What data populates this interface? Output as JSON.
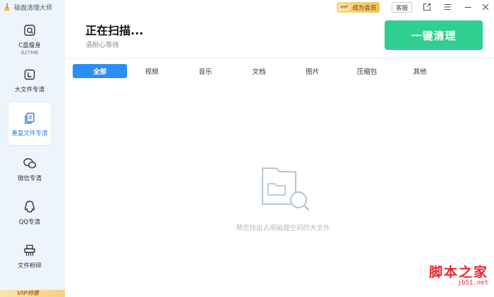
{
  "app": {
    "title": "磁盘清理大师"
  },
  "titlebar": {
    "vip_badge": "VIP",
    "vip_label": "成为会员",
    "service_label": "客服",
    "icons": [
      "share-icon",
      "menu-icon",
      "minimize-icon",
      "close-icon"
    ]
  },
  "sidebar": {
    "items": [
      {
        "label": "C盘瘦身",
        "sub": "627MB",
        "icon": "c-drive-icon"
      },
      {
        "label": "大文件专清",
        "icon": "large-file-icon"
      },
      {
        "label": "重复文件专清",
        "icon": "duplicate-file-icon",
        "active": true
      },
      {
        "label": "微信专清",
        "icon": "wechat-icon"
      },
      {
        "label": "QQ专清",
        "icon": "qq-icon"
      },
      {
        "label": "文件粉碎",
        "icon": "shredder-icon"
      }
    ],
    "vip_strip": "VIP特惠"
  },
  "header": {
    "title": "正在扫描...",
    "subtitle": "请耐心等待",
    "clean_button": "一键清理"
  },
  "tabs": [
    {
      "label": "全部",
      "active": true
    },
    {
      "label": "视频"
    },
    {
      "label": "音乐"
    },
    {
      "label": "文档"
    },
    {
      "label": "图片"
    },
    {
      "label": "压缩包"
    },
    {
      "label": "其他"
    }
  ],
  "empty_state": {
    "icon": "folder-search-icon",
    "text": "帮您找出占用磁盘空间的大文件"
  },
  "watermark": {
    "main": "脚本之家",
    "url": "jb51.net"
  },
  "colors": {
    "accent": "#2c8df4",
    "clean_button": "#2ecf91",
    "sidebar_bg": "#eef4fb",
    "vip_gold": "#f2c15a",
    "watermark_red": "#e8262d"
  }
}
